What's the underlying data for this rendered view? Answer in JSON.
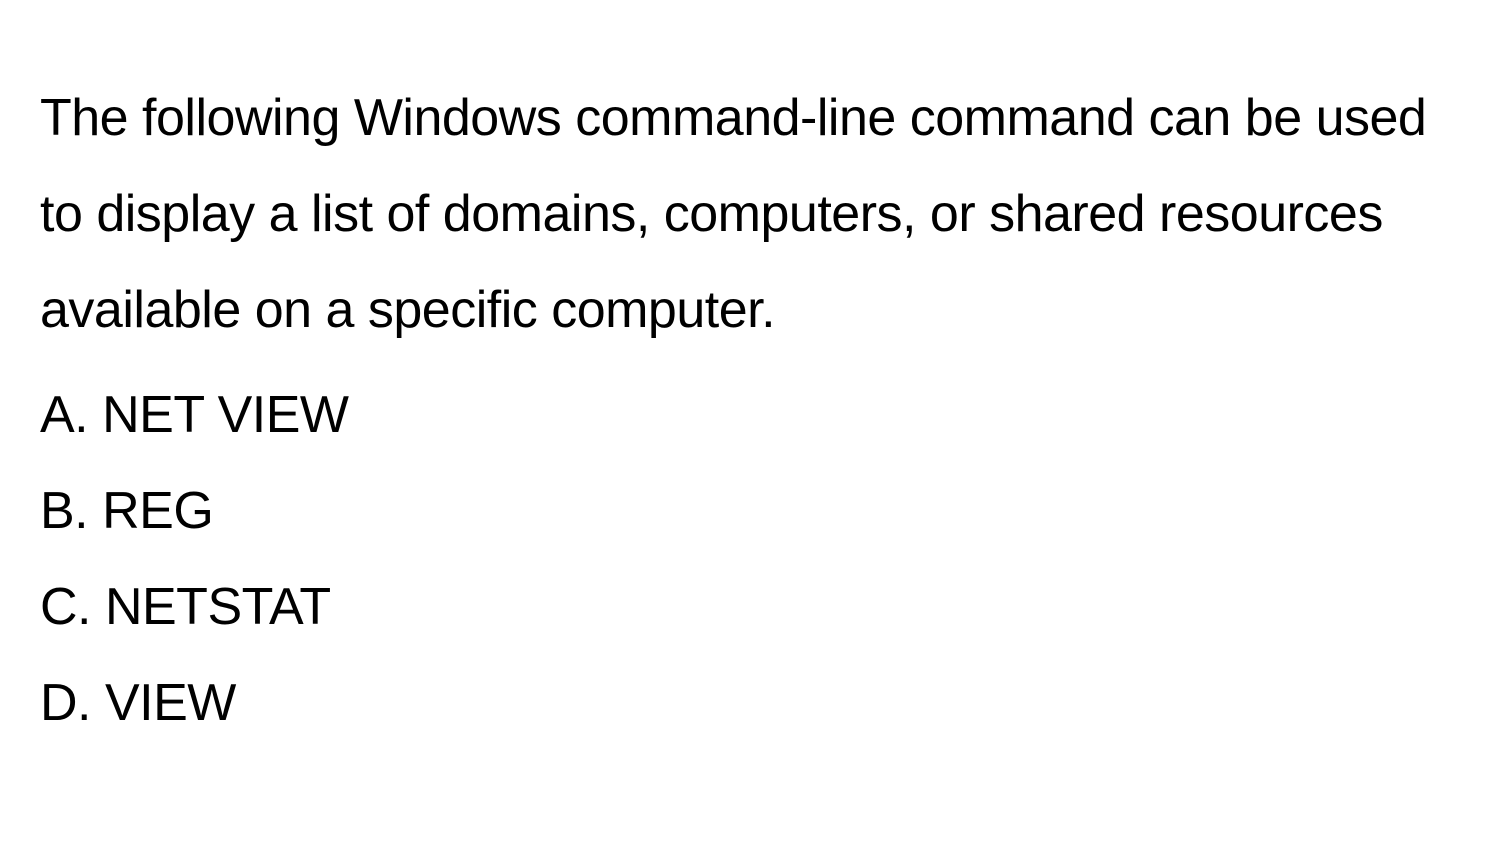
{
  "question": {
    "text": "The following Windows command-line command can be used to display a list of domains, computers, or shared resources available on a specific computer."
  },
  "options": {
    "a": "A. NET VIEW",
    "b": "B. REG",
    "c": "C. NETSTAT",
    "d": "D. VIEW"
  }
}
